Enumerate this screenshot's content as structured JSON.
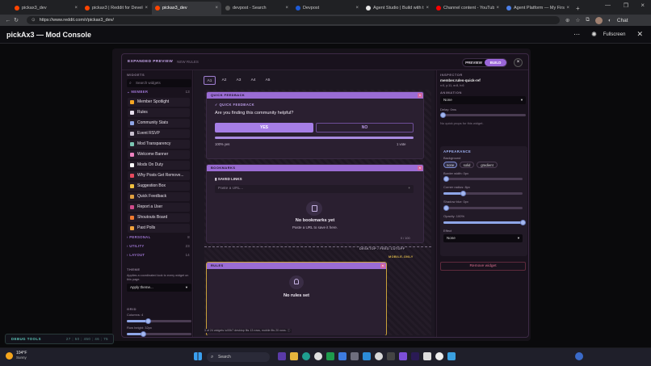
{
  "browser": {
    "tabs": [
      {
        "label": "pickax3_dev",
        "active": false,
        "color": "#ff4500"
      },
      {
        "label": "pickax3 | Reddit for Develo...",
        "active": false,
        "color": "#ff4500"
      },
      {
        "label": "pickax3_dev",
        "active": true,
        "color": "#ff4500"
      },
      {
        "label": "devpost - Search",
        "active": false,
        "color": "#5b5b5b"
      },
      {
        "label": "Devpost",
        "active": false,
        "color": "#1d5bd8"
      },
      {
        "label": "Agent Studio | Build with th...",
        "active": false,
        "color": "#e8e8e8"
      },
      {
        "label": "Channel content - YouTube ...",
        "active": false,
        "color": "#ff0000"
      },
      {
        "label": "Agent Platform — My First W...",
        "active": false,
        "color": "#4b7fe8"
      }
    ],
    "url": "https://www.reddit.com/r/pickax3_dev/",
    "chat_label": "Chat"
  },
  "app": {
    "title": "pickAx3 — Mod Console",
    "fullscreen_label": "Fullscreen"
  },
  "modal": {
    "title": "EXPANDED PREVIEW",
    "subtitle": "NEW RULES",
    "mode_preview": "PREVIEW",
    "mode_build": "BUILD",
    "close": "×"
  },
  "left_panel": {
    "widgets_label": "WIDGETS",
    "search_placeholder": "Search widgets",
    "categories": [
      {
        "label": "MEMBER",
        "count": "13"
      },
      {
        "label": "PERSONAL",
        "count": "8"
      },
      {
        "label": "UTILITY",
        "count": "23"
      },
      {
        "label": "LAYOUT",
        "count": "14"
      }
    ],
    "member_widgets": [
      {
        "label": "Member Spotlight",
        "color": "#f5a623"
      },
      {
        "label": "Rules",
        "color": "#e8e0ee"
      },
      {
        "label": "Community Stats",
        "color": "#8fa6e8"
      },
      {
        "label": "Event RSVP",
        "color": "#c9c0d0"
      },
      {
        "label": "Mod Transparency",
        "color": "#7cc7b4"
      },
      {
        "label": "Welcome Banner",
        "color": "#ee82c0"
      },
      {
        "label": "Mods On Duty",
        "color": "#ffffff"
      },
      {
        "label": "Why Posts Get Remove...",
        "color": "#e84a5f"
      },
      {
        "label": "Suggestion Box",
        "color": "#f0c040"
      },
      {
        "label": "Quick Feedback",
        "color": "#e0a040"
      },
      {
        "label": "Report a User",
        "color": "#d04c8c"
      },
      {
        "label": "Shoutouts Board",
        "color": "#f07a30"
      },
      {
        "label": "Past Polls",
        "color": "#f0a33c"
      }
    ],
    "theme_label": "THEME",
    "theme_text": "Applies a coordinated look to every widget on this page.",
    "theme_select": "Apply theme...",
    "grid_label": "GRID",
    "columns_label": "Columns: 4",
    "columns_value": 4,
    "columns_max": 12,
    "row_height_label": "Row height: 32px",
    "row_height_value": 32,
    "row_height_max": 128
  },
  "center": {
    "frame_tabs": [
      "A1",
      "A2",
      "A3",
      "A4",
      "A5"
    ],
    "active_tab": "A1",
    "widgets": {
      "quick_feedback": {
        "bar_label": "QUICK FEEDBACK",
        "heading": "QUICK FEEDBACK",
        "question": "Are you finding this community helpful?",
        "yes_label": "YES",
        "no_label": "NO",
        "yes_pct_label": "100% yes",
        "yes_fraction": 1.0,
        "votes_label": "1 vote"
      },
      "bookmarks": {
        "bar_label": "BOOKMARKS",
        "heading": "SAVED LINKS",
        "input_placeholder": "Paste a URL...",
        "counter": "0 / 100",
        "empty_title": "No bookmarks yet",
        "empty_text": "Paste a URL to save it here."
      },
      "rules": {
        "bar_label": "RULES",
        "empty_title": "No rules set"
      }
    },
    "cutoff_label": "DESKTOP / FEED CUTOFF",
    "mobile_label": "MOBILE-ONLY",
    "footer_text": "3 of 24 widgets \\u00b7 desktop fits 13 rows, mobile fits 20 rows."
  },
  "inspector": {
    "label": "INSPECTOR",
    "widget_id": "member.rules-quick-ref",
    "position": "x:0, y:11, w:8, h:6",
    "animation_label": "ANIMATION",
    "animation_value": "None",
    "delay_label": "Delay: 0ms",
    "delay_value": 0,
    "delay_max": 2000,
    "no_props": "No quick props for this widget.",
    "appearance_label": "APPEARANCE",
    "background_label": "Background",
    "bg_options": [
      "none",
      "solid",
      "gradient"
    ],
    "bg_selected": "none",
    "border_width_label": "Border width: 0px",
    "border_width_value": 0,
    "corner_radius_label": "Corner radius: 8px",
    "corner_radius_value": 8,
    "corner_radius_max": 32,
    "shadow_blur_label": "Shadow blur: 0px",
    "shadow_blur_value": 0,
    "opacity_label": "Opacity: 100%",
    "opacity_value": 1.0,
    "effect_label": "Effect",
    "effect_value": "None",
    "remove_label": "Remove widget"
  },
  "debug": {
    "label": "DEBUG TOOLS",
    "size": "27 ; 50 ; 450 ; 46 ; 75"
  },
  "taskbar": {
    "temp": "104°F",
    "condition": "Sunny",
    "search_placeholder": "Search"
  }
}
